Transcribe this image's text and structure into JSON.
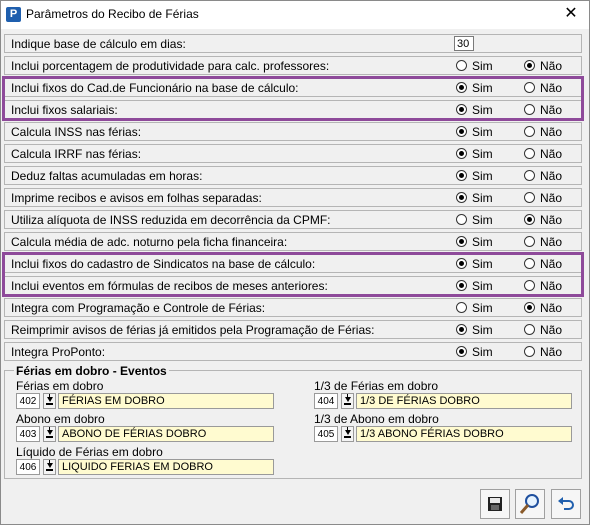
{
  "window": {
    "title": "Parâmetros do Recibo de Férias",
    "app_icon_letter": "P"
  },
  "options": {
    "sim": "Sim",
    "nao": "Não"
  },
  "rows": [
    {
      "label": "Indique base de cálculo em dias:",
      "value": "30"
    },
    {
      "label": "Inclui porcentagem de produtividade para calc. professores:",
      "selected": "nao"
    },
    {
      "label": "Inclui fixos do Cad.de Funcionário na base de cálculo:",
      "selected": "sim"
    },
    {
      "label": "Inclui fixos salariais:",
      "selected": "sim"
    },
    {
      "label": "Calcula INSS nas férias:",
      "selected": "sim"
    },
    {
      "label": "Calcula IRRF nas férias:",
      "selected": "sim"
    },
    {
      "label": "Deduz faltas acumuladas em horas:",
      "selected": "sim"
    },
    {
      "label": "Imprime recibos e avisos em folhas separadas:",
      "selected": "sim"
    },
    {
      "label": "Utiliza alíquota de INSS reduzida em decorrência da CPMF:",
      "selected": "nao"
    },
    {
      "label": "Calcula média de adc. noturno pela ficha financeira:",
      "selected": "sim"
    },
    {
      "label": "Inclui fixos do cadastro de Sindicatos na base de cálculo:",
      "selected": "sim"
    },
    {
      "label": "Inclui eventos em fórmulas de recibos de meses anteriores:",
      "selected": "sim"
    },
    {
      "label": "Integra com Programação e Controle de Férias:",
      "selected": "nao"
    },
    {
      "label": "Reimprimir avisos de férias já emitidos pela Programação de Férias:",
      "selected": "sim"
    },
    {
      "label": "Integra ProPonto:",
      "selected": "sim"
    }
  ],
  "eventos": {
    "title": "Férias em dobro - Eventos",
    "fields": [
      {
        "label": "Férias em dobro",
        "code": "402",
        "desc": "FÉRIAS EM DOBRO"
      },
      {
        "label": "1/3 de Férias em dobro",
        "code": "404",
        "desc": "1/3 DE FÉRIAS DOBRO"
      },
      {
        "label": "Abono em dobro",
        "code": "403",
        "desc": "ABONO DE FÉRIAS DOBRO"
      },
      {
        "label": "1/3 de Abono em dobro",
        "code": "405",
        "desc": "1/3 ABONO FÉRIAS DOBRO"
      },
      {
        "label": "Líquido de Férias em dobro",
        "code": "406",
        "desc": "LIQUIDO FERIAS EM DOBRO"
      }
    ]
  },
  "toolbar": {
    "save_icon": "save-icon",
    "search_icon": "magnifier-icon",
    "undo_icon": "undo-icon"
  },
  "colors": {
    "highlight": "#8e4a9a",
    "field_bg": "#fffbd0"
  }
}
